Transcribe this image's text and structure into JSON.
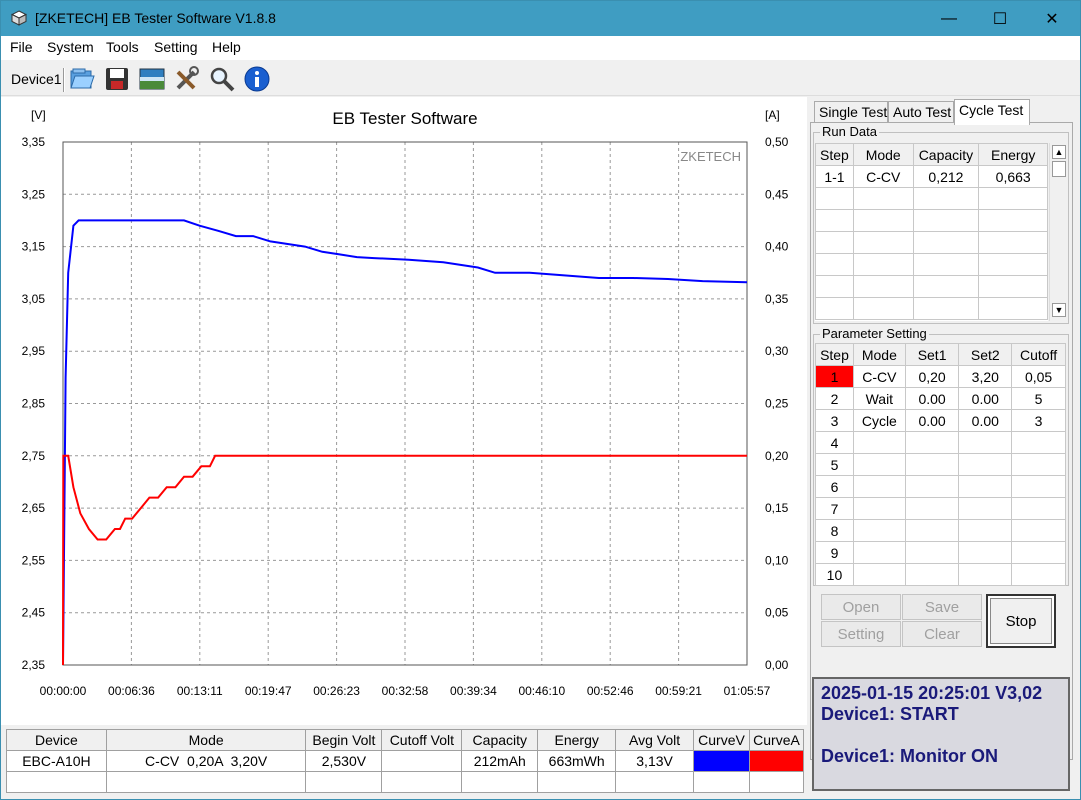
{
  "window": {
    "title": "[ZKETECH] EB Tester Software V1.8.8",
    "minimize": "—",
    "maximize": "☐",
    "close": "✕"
  },
  "menu": [
    "File",
    "System",
    "Tools",
    "Setting",
    "Help"
  ],
  "toolbar": {
    "device_label": "Device1",
    "icons": [
      "folder-open-icon",
      "save-icon",
      "chart-image-icon",
      "tools-icon",
      "magnifier-icon",
      "info-icon"
    ]
  },
  "chart_data": {
    "type": "line",
    "title": "EB Tester Software",
    "watermark": "ZKETECH",
    "ylabel_left": "[V]",
    "ylabel_right": "[A]",
    "xlabel": "",
    "ylim_left": [
      2.35,
      3.35
    ],
    "ylim_right": [
      0.0,
      0.5
    ],
    "xlim_seconds": [
      0,
      3957
    ],
    "grid": true,
    "left_ticks": [
      "3,35",
      "3,25",
      "3,15",
      "3,05",
      "2,95",
      "2,85",
      "2,75",
      "2,65",
      "2,55",
      "2,45",
      "2,35"
    ],
    "right_ticks": [
      "0,50",
      "0,45",
      "0,40",
      "0,35",
      "0,30",
      "0,25",
      "0,20",
      "0,15",
      "0,10",
      "0,05",
      "0,00"
    ],
    "x_ticks": [
      "00:00:00",
      "00:06:36",
      "00:13:11",
      "00:19:47",
      "00:26:23",
      "00:32:58",
      "00:39:34",
      "00:46:10",
      "00:52:46",
      "00:59:21",
      "01:05:57"
    ],
    "series": [
      {
        "name": "CurveV",
        "axis": "left",
        "color": "#0000ff",
        "x": [
          0,
          15,
          30,
          60,
          90,
          120,
          400,
          700,
          790,
          900,
          1000,
          1100,
          1200,
          1300,
          1400,
          1500,
          1600,
          1700,
          1800,
          2000,
          2200,
          2300,
          2400,
          2500,
          2700,
          2900,
          3100,
          3300,
          3500,
          3700,
          3957
        ],
        "y": [
          2.35,
          2.9,
          3.1,
          3.19,
          3.2,
          3.2,
          3.2,
          3.2,
          3.19,
          3.18,
          3.17,
          3.17,
          3.16,
          3.155,
          3.15,
          3.14,
          3.135,
          3.13,
          3.128,
          3.125,
          3.12,
          3.115,
          3.11,
          3.1,
          3.1,
          3.095,
          3.09,
          3.09,
          3.088,
          3.084,
          3.082
        ]
      },
      {
        "name": "CurveA",
        "axis": "right",
        "color": "#ff0000",
        "x": [
          0,
          2,
          30,
          60,
          100,
          150,
          200,
          250,
          300,
          330,
          360,
          400,
          450,
          500,
          550,
          600,
          650,
          700,
          750,
          800,
          850,
          880,
          900,
          1000,
          2000,
          3000,
          3957
        ],
        "y": [
          0.0,
          0.2,
          0.2,
          0.17,
          0.145,
          0.13,
          0.12,
          0.12,
          0.13,
          0.13,
          0.14,
          0.14,
          0.15,
          0.16,
          0.16,
          0.17,
          0.17,
          0.18,
          0.18,
          0.19,
          0.19,
          0.2,
          0.2,
          0.2,
          0.2,
          0.2,
          0.2
        ]
      }
    ]
  },
  "bottom_table": {
    "headers": [
      "Device",
      "Mode",
      "Begin Volt",
      "Cutoff Volt",
      "Capacity",
      "Energy",
      "Avg Volt",
      "CurveV",
      "CurveA"
    ],
    "row": [
      "EBC-A10H",
      "C-CV  0,20A  3,20V",
      "2,530V",
      "",
      "212mAh",
      "663mWh",
      "3,13V"
    ],
    "curve_colors": [
      "#0000ff",
      "#ff0000"
    ]
  },
  "tabs": [
    "Single Test",
    "Auto Test",
    "Cycle Test"
  ],
  "active_tab": "Cycle Test",
  "run_data": {
    "label": "Run Data",
    "headers": [
      "Step",
      "Mode",
      "Capacity",
      "Energy"
    ],
    "rows": [
      [
        "1-1",
        "C-CV",
        "0,212",
        "0,663"
      ]
    ]
  },
  "parameter_setting": {
    "label": "Parameter Setting",
    "headers": [
      "Step",
      "Mode",
      "Set1",
      "Set2",
      "Cutoff"
    ],
    "rows": [
      [
        "1",
        "C-CV",
        "0,20",
        "3,20",
        "0,05"
      ],
      [
        "2",
        "Wait",
        "0.00",
        "0.00",
        "5"
      ],
      [
        "3",
        "Cycle",
        "0.00",
        "0.00",
        "3"
      ],
      [
        "4",
        "",
        "",
        "",
        ""
      ],
      [
        "5",
        "",
        "",
        "",
        ""
      ],
      [
        "6",
        "",
        "",
        "",
        ""
      ],
      [
        "7",
        "",
        "",
        "",
        ""
      ],
      [
        "8",
        "",
        "",
        "",
        ""
      ],
      [
        "9",
        "",
        "",
        "",
        ""
      ],
      [
        "10",
        "",
        "",
        "",
        ""
      ]
    ],
    "active_step_color": "#ff0000"
  },
  "buttons": {
    "open": "Open",
    "save": "Save",
    "setting": "Setting",
    "clear": "Clear",
    "stop": "Stop"
  },
  "status": {
    "line1": "2025-01-15 20:25:01  V3,02",
    "line2": "Device1: START",
    "line3": "",
    "line4": "Device1: Monitor ON"
  }
}
